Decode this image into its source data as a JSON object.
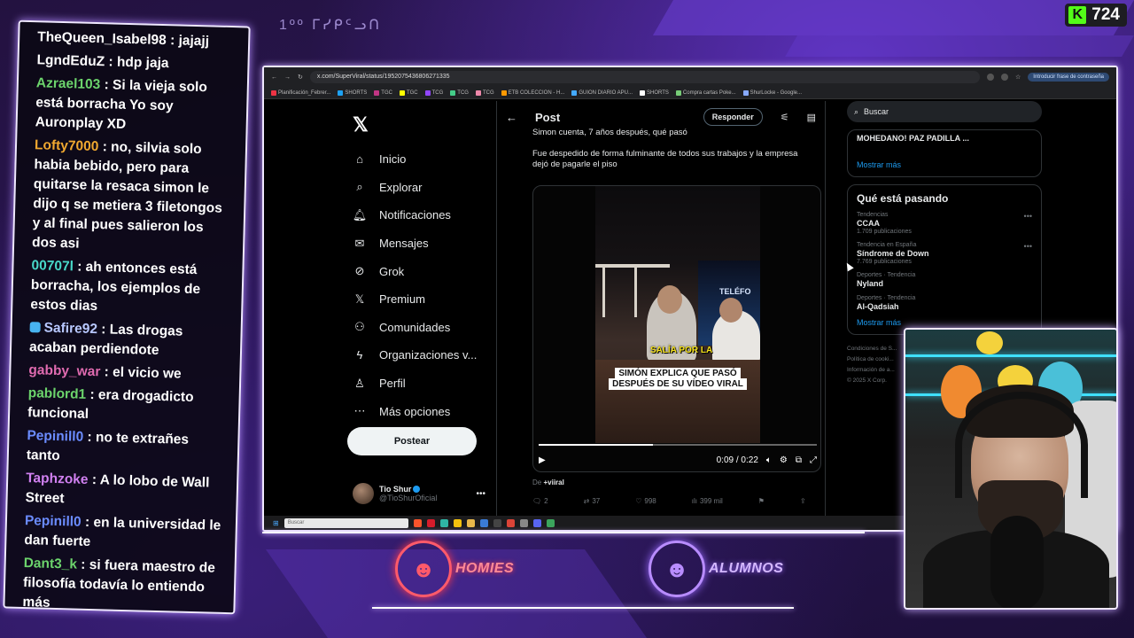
{
  "kick": {
    "viewers": "724",
    "logo": "K"
  },
  "handwriting": "1ºº ᒥᓯᑭᑦᓗᑎ",
  "chat": [
    {
      "user": "TheQueen_Isabel98",
      "color": "#ffffff",
      "text": ": jajajj"
    },
    {
      "user": "LgndEduZ",
      "color": "#ffffff",
      "text": ": hdp jaja"
    },
    {
      "user": "Azrael103",
      "color": "#6cd46c",
      "text": ": Si la vieja solo está borracha Yo soy Auronplay XD"
    },
    {
      "user": "Lofty7000",
      "color": "#f0a830",
      "text": ": no, silvia solo habia bebido, pero para quitarse la resaca simon le dijo q se metiera 3 filetongos y al final pues salieron los dos asi"
    },
    {
      "user": "00707l",
      "color": "#48d8c8",
      "text": ": ah entonces está borracha, los ejemplos de estos dias"
    },
    {
      "user": "Safire92",
      "color": "#b8c8ff",
      "text": ": Las drogas acaban perdiendote"
    },
    {
      "user": "gabby_war",
      "color": "#e06bb0",
      "text": ": el vicio we"
    },
    {
      "user": "pablord1",
      "color": "#6cd46c",
      "text": ": era drogadicto funcional"
    },
    {
      "user": "Pepinill0",
      "color": "#6b8cff",
      "text": ": no te extrañes tanto"
    },
    {
      "user": "Taphzoke",
      "color": "#d080f0",
      "text": ": A lo lobo de Wall Street"
    },
    {
      "user": "Pepinill0",
      "color": "#6b8cff",
      "text": ": en la universidad le dan fuerte"
    },
    {
      "user": "Dant3_k",
      "color": "#6cd46c",
      "text": ": si fuera maestro de filosofía todavía lo entiendo más"
    }
  ],
  "browser": {
    "url": "x.com/SuperViral/status/1952075436806271335",
    "password_chip": "Introducir frase de contraseña",
    "bookmarks": [
      "Planificación_Febrer...",
      "SHORTS",
      "TGC",
      "TGC",
      "TCG",
      "TCG",
      "TCG",
      "ETB COLECCION - H...",
      "GUION DIARIO APU...",
      "SHORTS",
      "Compra cartas Poke...",
      "ShurLocke - Google..."
    ]
  },
  "x": {
    "nav": [
      {
        "label": "Inicio",
        "icon": "home-icon",
        "glyph": "⌂"
      },
      {
        "label": "Explorar",
        "icon": "search-icon",
        "glyph": "⌕"
      },
      {
        "label": "Notificaciones",
        "icon": "bell-icon",
        "glyph": "🔔︎"
      },
      {
        "label": "Mensajes",
        "icon": "mail-icon",
        "glyph": "✉"
      },
      {
        "label": "Grok",
        "icon": "grok-icon",
        "glyph": "⊘"
      },
      {
        "label": "Premium",
        "icon": "x-icon",
        "glyph": "𝕏"
      },
      {
        "label": "Comunidades",
        "icon": "people-icon",
        "glyph": "⚇"
      },
      {
        "label": "Organizaciones v...",
        "icon": "bolt-icon",
        "glyph": "ϟ"
      },
      {
        "label": "Perfil",
        "icon": "person-icon",
        "glyph": "♙"
      },
      {
        "label": "Más opciones",
        "icon": "more-icon",
        "glyph": "⋯"
      }
    ],
    "post_button": "Postear",
    "profile": {
      "name": "Tio Shur",
      "handle": "@TioShurOficial"
    },
    "post": {
      "header": "Post",
      "reply_button": "Responder",
      "text1": "Simon cuenta, 7 años después, qué pasó",
      "text2": "Fue despedido de forma fulminante de todos sus trabajos y la empresa dejó de pagarle el piso",
      "caption_top": "SALÍA POR LA",
      "caption_main": "SIMÓN EXPLICA QUE PASÓ DESPUÉS DE SU VÍDEO VIRAL",
      "video_time": "0:09 / 0:22",
      "video_progress": 0.41,
      "from_label": "De",
      "from_user": "+viiral",
      "replies": "2",
      "reposts": "37",
      "likes": "998",
      "views": "399 mil"
    },
    "search_placeholder": "Buscar",
    "top_card": {
      "user": "MOHEDANO! PAZ PADILLA ...",
      "link": "Mostrar más"
    },
    "trending": {
      "title": "Qué está pasando",
      "items": [
        {
          "context": "Tendencias",
          "name": "CCAA",
          "posts": "1.709 publicaciones"
        },
        {
          "context": "Tendencia en España",
          "name": "Síndrome de Down",
          "posts": "7.769 publicaciones"
        },
        {
          "context": "Deportes · Tendencia",
          "name": "Nyland",
          "posts": ""
        },
        {
          "context": "Deportes · Tendencia",
          "name": "Al-Qadsiah",
          "posts": ""
        }
      ],
      "link": "Mostrar más"
    },
    "footer": [
      "Condiciones de S...",
      "Política de cooki...",
      "Información de a...",
      "© 2025 X Corp."
    ]
  },
  "taskbar": {
    "search": "Buscar"
  },
  "logos": [
    {
      "word": "HOMIES",
      "color": "#ff5a6a"
    },
    {
      "word": "ALUMNOS",
      "color": "#b88cff"
    }
  ]
}
